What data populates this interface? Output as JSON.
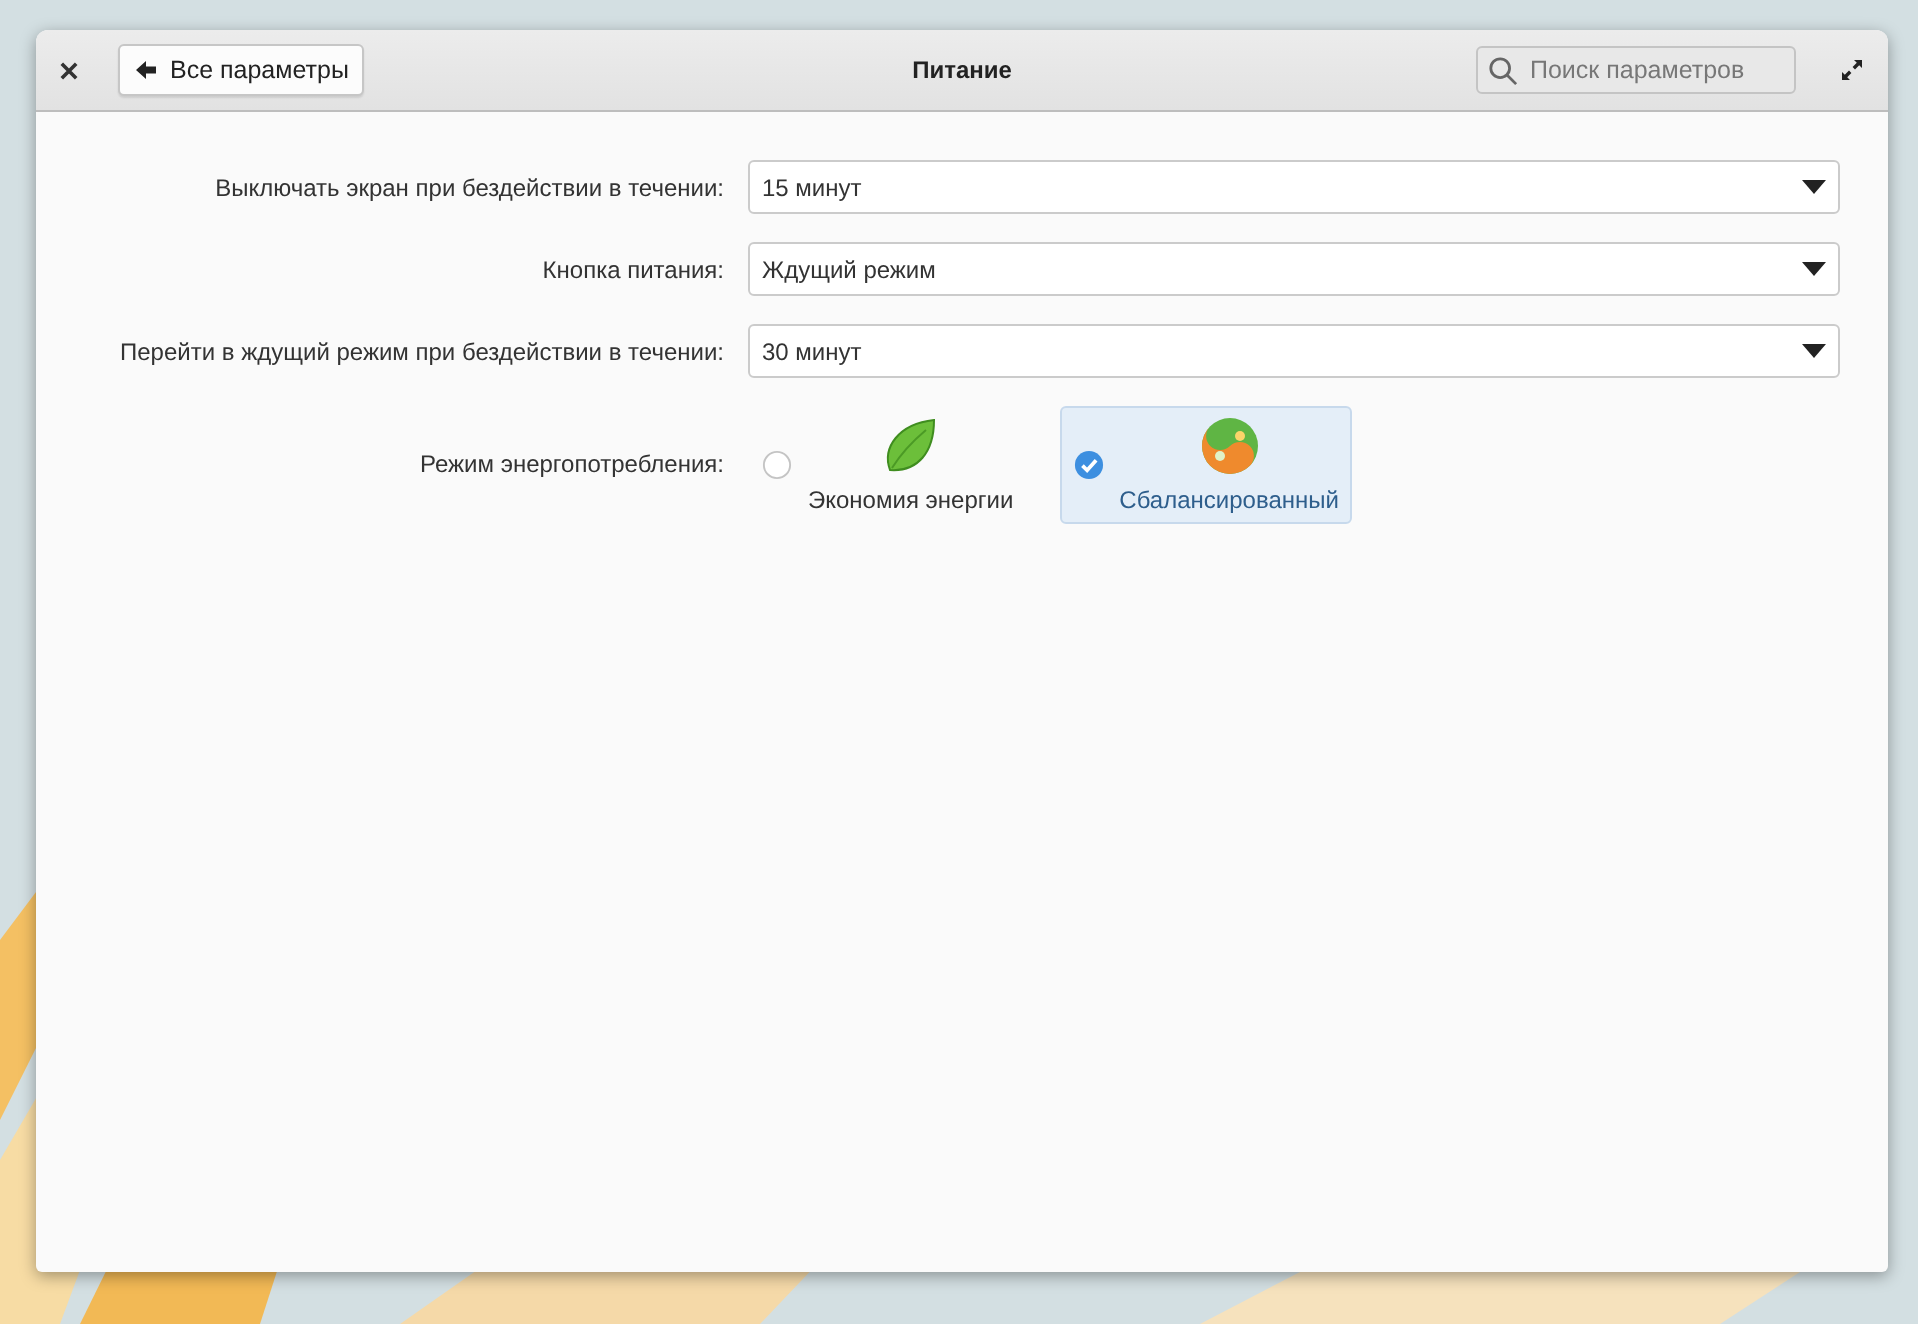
{
  "window": {
    "title": "Питание",
    "back_button": "Все параметры",
    "search": {
      "placeholder": "Поиск параметров"
    }
  },
  "settings": [
    {
      "label": "Выключать экран при бездействии в течении:",
      "value": "15 минут"
    },
    {
      "label": "Кнопка питания:",
      "value": "Ждущий режим"
    },
    {
      "label": "Перейти в ждущий режим при бездействии в течении:",
      "value": "30 минут"
    }
  ],
  "power_mode": {
    "label": "Режим энергопотребления:",
    "options": [
      {
        "kind": "saver",
        "label": "Экономия энергии",
        "selected": false
      },
      {
        "kind": "balanced",
        "label": "Сбалансированный",
        "selected": true
      }
    ]
  }
}
